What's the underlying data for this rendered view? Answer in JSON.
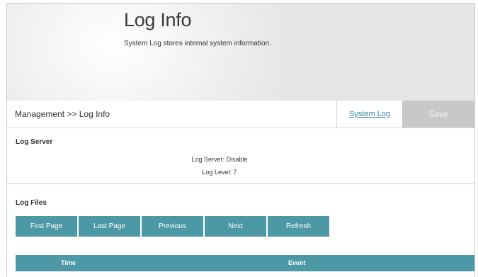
{
  "header": {
    "title": "Log Info",
    "description": "System Log stores internal system information."
  },
  "toolbar": {
    "breadcrumb": "Management >> Log Info",
    "system_log_link": "System Log",
    "save_label": "Save"
  },
  "log_server": {
    "section_title": "Log Server",
    "server_line": "Log Server: Disable",
    "level_line": "Log Level: 7"
  },
  "log_files": {
    "section_title": "Log Files",
    "buttons": [
      "First Page",
      "Last Page",
      "Previous",
      "Next",
      "Refresh"
    ],
    "table_columns": [
      "Time",
      "Event"
    ]
  },
  "colors": {
    "accent": "#4d98a6",
    "save_disabled": "#c8c8c8",
    "link": "#3a7fa0"
  }
}
